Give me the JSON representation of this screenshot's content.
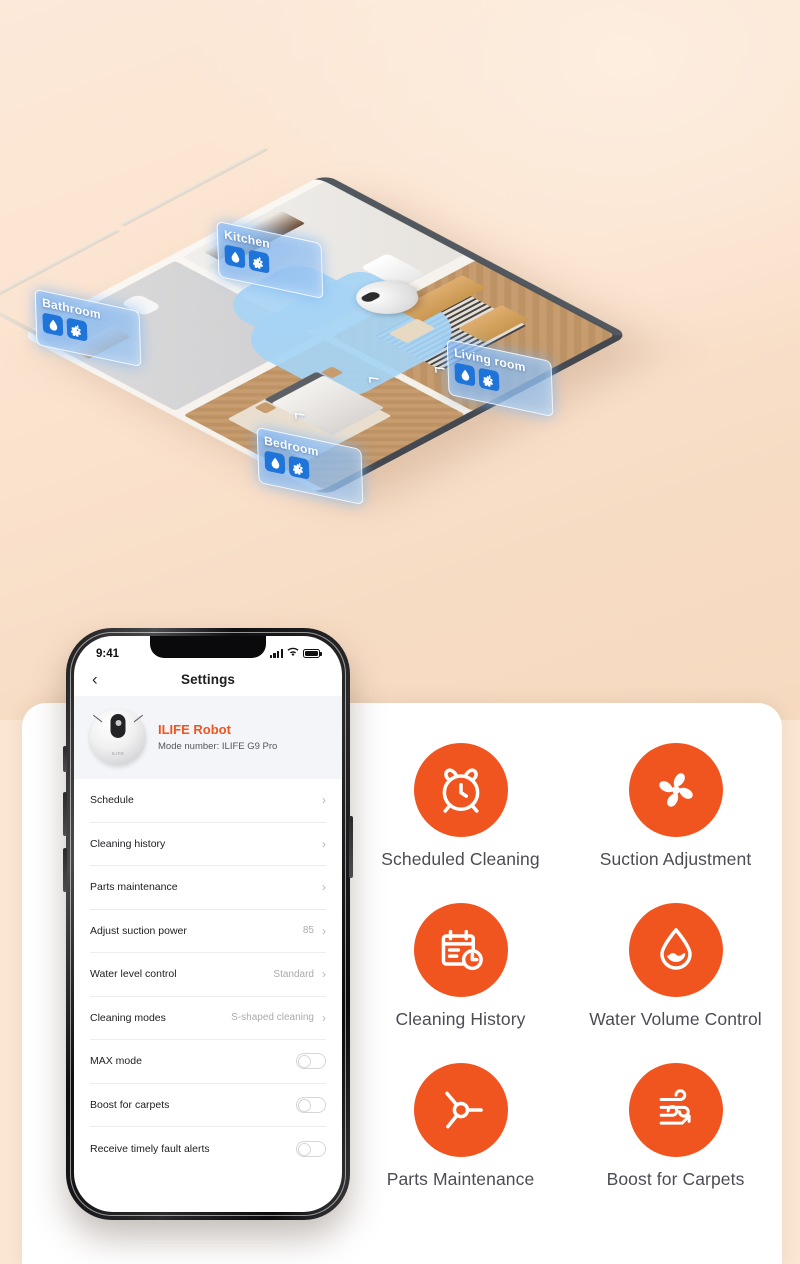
{
  "colors": {
    "accent": "#F0551F",
    "chip_blue": "#1E74D8",
    "bg_peach": "#FBE6D3"
  },
  "hero": {
    "rooms": [
      {
        "name": "Bathroom",
        "chips": [
          "water-drop-icon",
          "fan-icon"
        ]
      },
      {
        "name": "Kitchen",
        "chips": [
          "water-drop-icon",
          "fan-icon"
        ]
      },
      {
        "name": "Bedroom",
        "chips": [
          "water-drop-icon",
          "fan-icon"
        ]
      },
      {
        "name": "Living room",
        "chips": [
          "water-drop-icon",
          "fan-icon"
        ]
      }
    ],
    "path_arrows": [
      "⌐",
      "⌐",
      "⌐"
    ]
  },
  "phone": {
    "statusbar": {
      "time": "9:41",
      "signal_icon": "cellular-bars-icon",
      "wifi_icon": "wifi-icon",
      "battery_icon": "battery-icon"
    },
    "nav": {
      "back_icon": "‹",
      "title": "Settings"
    },
    "device": {
      "image_icon": "robot-vacuum-icon",
      "name": "ILIFE Robot",
      "model": "Mode number: ILIFE G9 Pro"
    },
    "settings": [
      {
        "label": "Schedule",
        "value": "",
        "control": "chevron"
      },
      {
        "label": "Cleaning history",
        "value": "",
        "control": "chevron"
      },
      {
        "label": "Parts maintenance",
        "value": "",
        "control": "chevron"
      },
      {
        "label": "Adjust suction power",
        "value": "85",
        "control": "chevron"
      },
      {
        "label": "Water level control",
        "value": "Standard",
        "control": "chevron"
      },
      {
        "label": "Cleaning modes",
        "value": "S-shaped cleaning",
        "control": "chevron"
      },
      {
        "label": "MAX mode",
        "value": "",
        "control": "toggle",
        "on": false
      },
      {
        "label": "Boost for carpets",
        "value": "",
        "control": "toggle",
        "on": false
      },
      {
        "label": "Receive timely fault alerts",
        "value": "",
        "control": "toggle",
        "on": false
      }
    ]
  },
  "features": [
    {
      "label": "Scheduled Cleaning",
      "icon": "alarm-clock-icon"
    },
    {
      "label": "Suction Adjustment",
      "icon": "fan-blades-icon"
    },
    {
      "label": "Cleaning History",
      "icon": "calendar-clock-icon"
    },
    {
      "label": "Water Volume Control",
      "icon": "water-drop-icon"
    },
    {
      "label": "Parts Maintenance",
      "icon": "brush-rotor-icon"
    },
    {
      "label": "Boost for Carpets",
      "icon": "airflow-boost-icon"
    }
  ]
}
